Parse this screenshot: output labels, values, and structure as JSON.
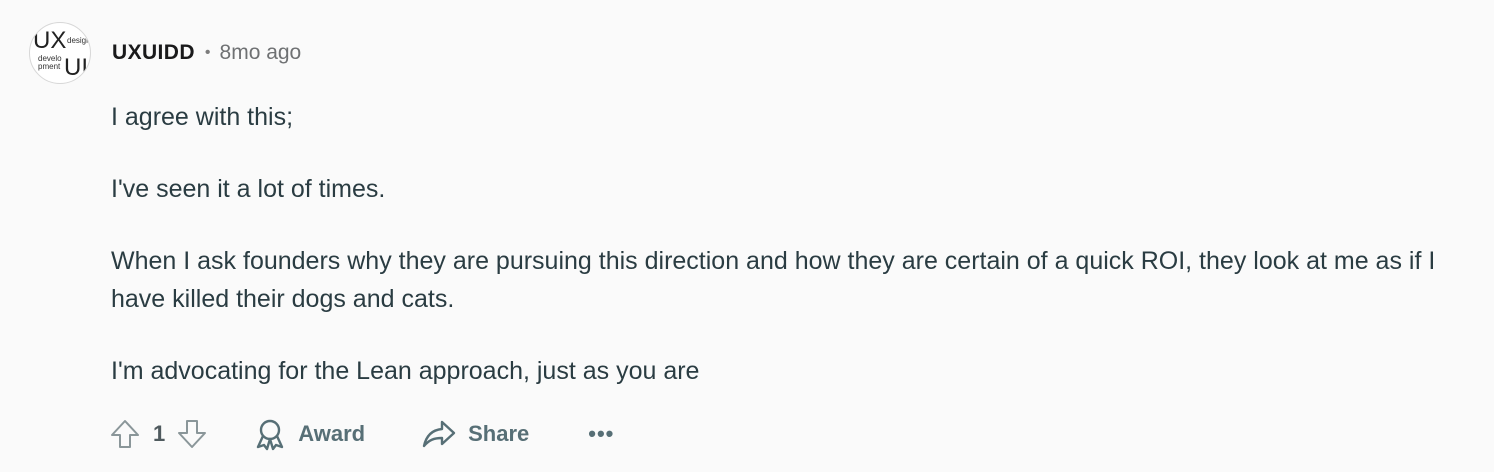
{
  "comment": {
    "author": "UXUIDD",
    "separator": "•",
    "timestamp": "8mo ago",
    "avatar": {
      "text_top": "UX",
      "text_bottom": "UI",
      "text_small_right": "design",
      "text_small_left_1": "develo",
      "text_small_left_2": "pment"
    },
    "paragraphs": [
      "I agree with this;",
      "I've seen it a lot of times.",
      "When I ask founders why they are pursuing this direction and how they are certain of a quick ROI, they look at me as if I have killed their dogs and cats.",
      "I'm advocating for the Lean approach, just as you are"
    ],
    "actions": {
      "vote_count": "1",
      "award_label": "Award",
      "share_label": "Share",
      "more_label": "•••"
    }
  },
  "colors": {
    "background": "#fafafa",
    "text": "#2a3c42",
    "muted": "#576f76"
  }
}
